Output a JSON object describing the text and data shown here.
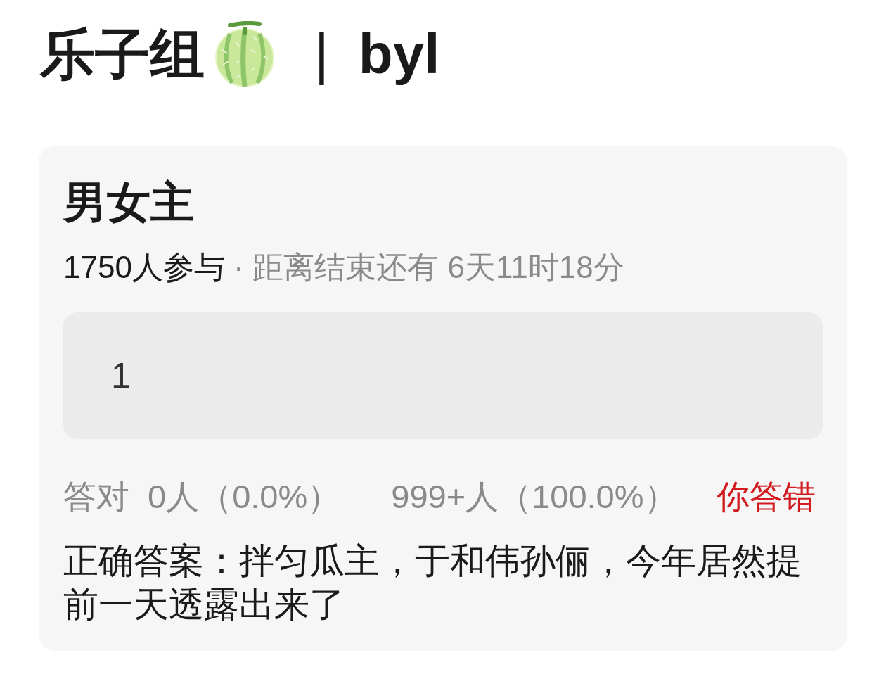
{
  "header": {
    "group": "乐子组",
    "separator": "|",
    "name": "byl"
  },
  "poll": {
    "title": "男女主",
    "participants": "1750人参与",
    "dot": "·",
    "countdown_label": "距离结束还有",
    "countdown": "6天11时18分",
    "options": [
      {
        "label": "1"
      }
    ]
  },
  "result": {
    "correct_label": "答对",
    "correct_count": "0人（0.0%）",
    "other_count": "999+人（100.0%）",
    "verdict": "你答错",
    "correct": false
  },
  "answer": {
    "text": "正确答案：拌匀瓜主，于和伟孙俪，今年居然提前一天透露出来了"
  }
}
